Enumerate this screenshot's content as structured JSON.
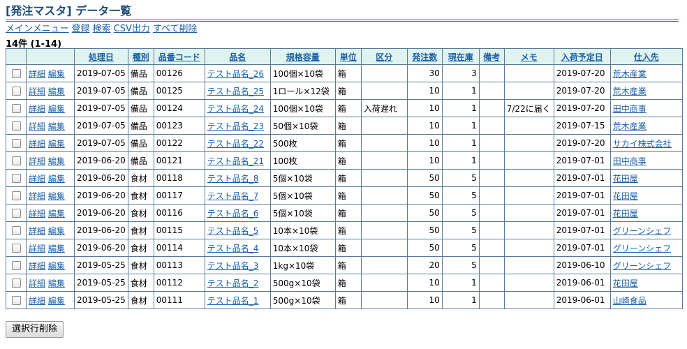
{
  "page": {
    "title": "[発注マスタ] データ一覧"
  },
  "nav": [
    {
      "label": "メインメニュー",
      "name": "nav-main-menu"
    },
    {
      "label": "登録",
      "name": "nav-register"
    },
    {
      "label": "検索",
      "name": "nav-search"
    },
    {
      "label": "CSV出力",
      "name": "nav-csv-export"
    },
    {
      "label": "すべて削除",
      "name": "nav-delete-all"
    }
  ],
  "summary": {
    "count_label": "14件 (1-14)"
  },
  "columns": [
    {
      "label": "",
      "link": false
    },
    {
      "label": "",
      "link": false
    },
    {
      "label": "処理日",
      "link": true
    },
    {
      "label": "種別",
      "link": true
    },
    {
      "label": "品番コード",
      "link": true
    },
    {
      "label": "品名",
      "link": true
    },
    {
      "label": "規格容量",
      "link": true
    },
    {
      "label": "単位",
      "link": true
    },
    {
      "label": "区分",
      "link": true
    },
    {
      "label": "発注数",
      "link": true
    },
    {
      "label": "現在庫",
      "link": true
    },
    {
      "label": "備考",
      "link": true
    },
    {
      "label": "メモ",
      "link": true
    },
    {
      "label": "入荷予定日",
      "link": true
    },
    {
      "label": "仕入先",
      "link": true
    }
  ],
  "actions": {
    "detail": "詳細",
    "edit": "編集"
  },
  "rows": [
    {
      "date": "2019-07-05",
      "type": "備品",
      "code": "00126",
      "name": "テスト品名_26",
      "spec": "100個×10袋",
      "unit": "箱",
      "category": "",
      "order_qty": "30",
      "stock": "3",
      "remarks": "",
      "memo": "",
      "arrival": "2019-07-20",
      "supplier": "荒木産業"
    },
    {
      "date": "2019-07-05",
      "type": "備品",
      "code": "00125",
      "name": "テスト品名_25",
      "spec": "1ロール×12袋",
      "unit": "箱",
      "category": "",
      "order_qty": "10",
      "stock": "1",
      "remarks": "",
      "memo": "",
      "arrival": "2019-07-20",
      "supplier": "荒木産業"
    },
    {
      "date": "2019-07-05",
      "type": "備品",
      "code": "00124",
      "name": "テスト品名_24",
      "spec": "100個×10袋",
      "unit": "箱",
      "category": "入荷遅れ",
      "order_qty": "10",
      "stock": "1",
      "remarks": "",
      "memo": "7/22に届く",
      "arrival": "2019-07-20",
      "supplier": "田中商事"
    },
    {
      "date": "2019-07-05",
      "type": "備品",
      "code": "00123",
      "name": "テスト品名_23",
      "spec": "50個×10袋",
      "unit": "箱",
      "category": "",
      "order_qty": "10",
      "stock": "1",
      "remarks": "",
      "memo": "",
      "arrival": "2019-07-15",
      "supplier": "荒木産業"
    },
    {
      "date": "2019-07-05",
      "type": "備品",
      "code": "00122",
      "name": "テスト品名_22",
      "spec": "500枚",
      "unit": "箱",
      "category": "",
      "order_qty": "10",
      "stock": "1",
      "remarks": "",
      "memo": "",
      "arrival": "2019-07-20",
      "supplier": "サカイ株式会社"
    },
    {
      "date": "2019-06-20",
      "type": "備品",
      "code": "00121",
      "name": "テスト品名_21",
      "spec": "100枚",
      "unit": "箱",
      "category": "",
      "order_qty": "10",
      "stock": "1",
      "remarks": "",
      "memo": "",
      "arrival": "2019-07-01",
      "supplier": "田中商事"
    },
    {
      "date": "2019-06-20",
      "type": "食材",
      "code": "00118",
      "name": "テスト品名_8",
      "spec": "5個×10袋",
      "unit": "箱",
      "category": "",
      "order_qty": "50",
      "stock": "5",
      "remarks": "",
      "memo": "",
      "arrival": "2019-07-01",
      "supplier": "花田屋"
    },
    {
      "date": "2019-06-20",
      "type": "食材",
      "code": "00117",
      "name": "テスト品名_7",
      "spec": "5個×10袋",
      "unit": "箱",
      "category": "",
      "order_qty": "50",
      "stock": "5",
      "remarks": "",
      "memo": "",
      "arrival": "2019-07-01",
      "supplier": "花田屋"
    },
    {
      "date": "2019-06-20",
      "type": "食材",
      "code": "00116",
      "name": "テスト品名_6",
      "spec": "5個×10袋",
      "unit": "箱",
      "category": "",
      "order_qty": "50",
      "stock": "5",
      "remarks": "",
      "memo": "",
      "arrival": "2019-07-01",
      "supplier": "花田屋"
    },
    {
      "date": "2019-06-20",
      "type": "食材",
      "code": "00115",
      "name": "テスト品名_5",
      "spec": "10本×10袋",
      "unit": "箱",
      "category": "",
      "order_qty": "50",
      "stock": "5",
      "remarks": "",
      "memo": "",
      "arrival": "2019-07-01",
      "supplier": "グリーンシェフ"
    },
    {
      "date": "2019-06-20",
      "type": "食材",
      "code": "00114",
      "name": "テスト品名_4",
      "spec": "10本×10袋",
      "unit": "箱",
      "category": "",
      "order_qty": "50",
      "stock": "5",
      "remarks": "",
      "memo": "",
      "arrival": "2019-07-01",
      "supplier": "グリーンシェフ"
    },
    {
      "date": "2019-05-25",
      "type": "食材",
      "code": "00113",
      "name": "テスト品名_3",
      "spec": "1kg×10袋",
      "unit": "箱",
      "category": "",
      "order_qty": "20",
      "stock": "5",
      "remarks": "",
      "memo": "",
      "arrival": "2019-06-10",
      "supplier": "グリーンシェフ"
    },
    {
      "date": "2019-05-25",
      "type": "食材",
      "code": "00112",
      "name": "テスト品名_2",
      "spec": "500g×10袋",
      "unit": "箱",
      "category": "",
      "order_qty": "10",
      "stock": "1",
      "remarks": "",
      "memo": "",
      "arrival": "2019-06-01",
      "supplier": "花田屋"
    },
    {
      "date": "2019-05-25",
      "type": "食材",
      "code": "00111",
      "name": "テスト品名_1",
      "spec": "500g×10袋",
      "unit": "箱",
      "category": "",
      "order_qty": "10",
      "stock": "1",
      "remarks": "",
      "memo": "",
      "arrival": "2019-06-01",
      "supplier": "山崎食品"
    }
  ],
  "footer": {
    "delete_selected_label": "選択行削除"
  }
}
